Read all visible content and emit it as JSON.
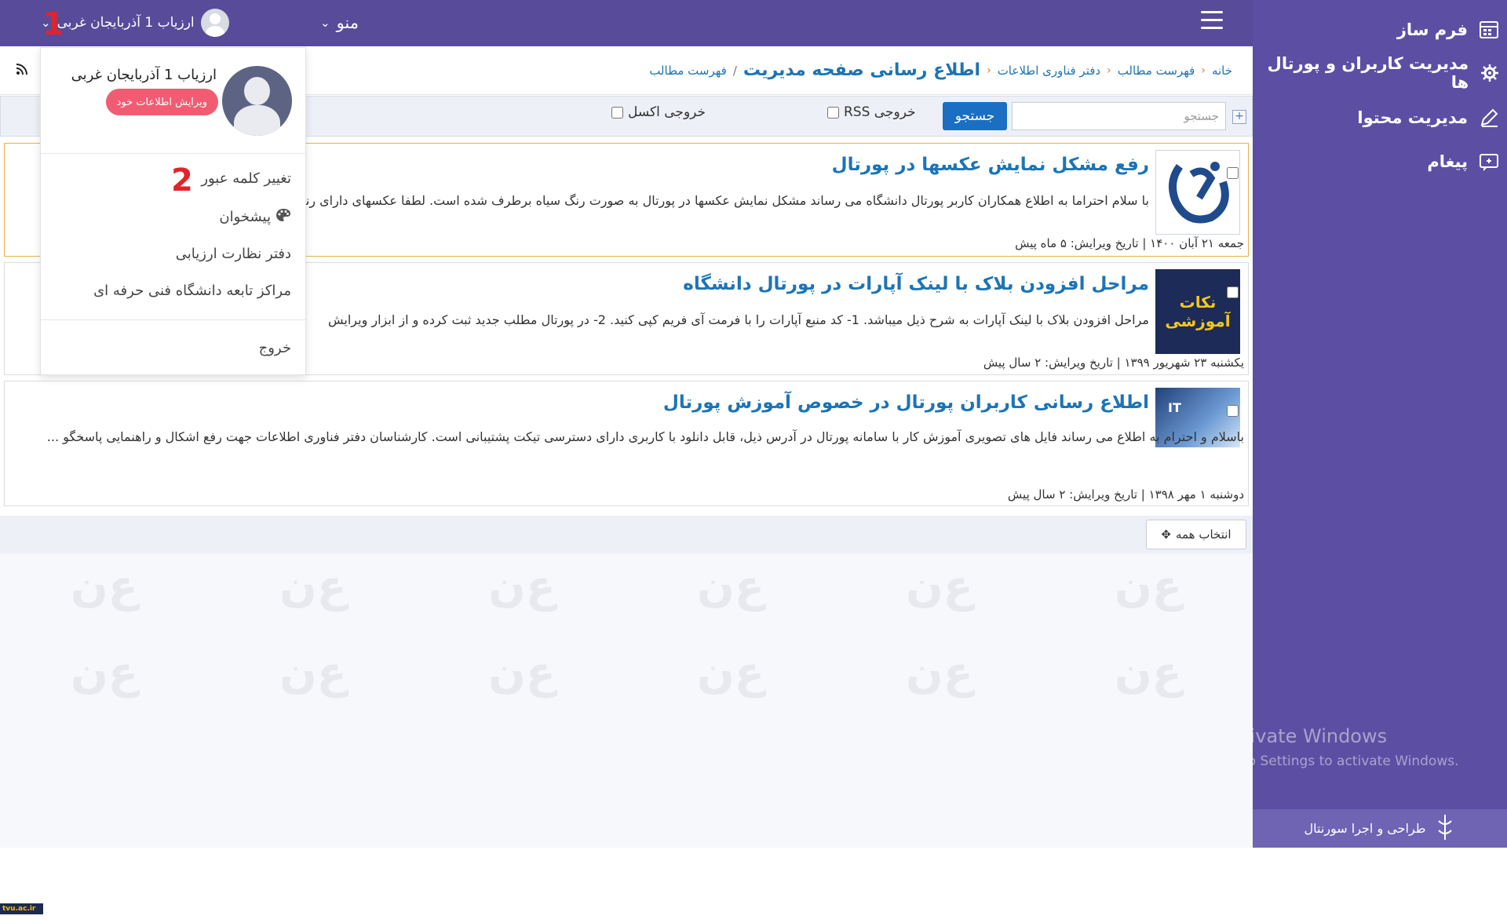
{
  "topbar": {
    "menu_label": "منو",
    "user_label": "ارزیاب 1 آذربایجان غربی",
    "annotation_1": "1",
    "annotation_2": "2"
  },
  "sidebar": {
    "items": [
      {
        "label": "فرم ساز",
        "icon": "calendar-icon"
      },
      {
        "label": "مدیریت کاربران و پورتال ها",
        "icon": "users-gear-icon"
      },
      {
        "label": "مدیریت محتوا",
        "icon": "edit-icon"
      },
      {
        "label": "پیغام",
        "icon": "message-icon"
      }
    ],
    "footer": "طراحی و اجرا سورنتال"
  },
  "watermark": {
    "line1": "Activate Windows",
    "line2": "Go to Settings to activate Windows."
  },
  "breadcrumb": {
    "home": "خانه",
    "list": "فهرست مطالب",
    "office": "دفتر فناوری اطلاعات",
    "title": "اطلاع رسانی صفحه مدیریت",
    "slash": "/",
    "list_link": "فهرست مطالب"
  },
  "toolbar": {
    "search_placeholder": "جستجو",
    "search_button": "جستجو",
    "rss_label": "خروجی RSS",
    "excel_label": "خروجی اکسل"
  },
  "items": [
    {
      "title": "رفع مشکل نمایش عکسها در پورتال",
      "text": "با سلام احتراما به اطلاع همکاران کاربر پورتال دانشگاه می رساند مشکل نمایش عکسها در پورتال به صورت رنگ سیاه برطرف شده است. لطفا عکسهای دارای رنگ سیاه را مجددا بارگذاری نمایید",
      "meta": "جمعه ۲۱ آبان ۱۴۰۰ | تاریخ ویرایش: ۵ ماه پیش"
    },
    {
      "title": "مراحل افزودن بلاک با لینک آپارات در پورتال دانشگاه",
      "text": "مراحل افزودن بلاک با لینک آپارات به شرح ذیل میباشد. 1- کد منبع آپارات را با فرمت آی فریم کپی کنید. 2- در پورتال مطلب جدید ثبت کرده و از ابزار ویرایش",
      "meta": "یکشنبه ۲۳ شهریور ۱۳۹۹ | تاریخ ویرایش: ۲ سال پیش",
      "thumb_text": "نکات آموزشی"
    },
    {
      "title": "اطلاع رسانی کاربران پورتال در خصوص آموزش پورتال",
      "text": "باسلام و احترام به اطلاع می رساند فایل های تصویری آموزش کار با سامانه پورتال در آدرس ذیل، قابل دانلود با کاربری دارای دسترسی تیکت پشتیبانی است. کارشناسان دفتر فناوری اطلاعات جهت رفع اشکال و راهنمایی پاسخگو ...",
      "meta": "دوشنبه ۱ مهر ۱۳۹۸ | تاریخ ویرایش: ۲ سال پیش",
      "thumb_text": "IT"
    }
  ],
  "select_all": "انتخاب همه",
  "dropdown": {
    "name": "ارزیاب 1 آذربایجان غربی",
    "edit_button": "ویرایش اطلاعات خود",
    "items": [
      "تغییر کلمه عبور",
      "پیشخوان",
      "دفتر نظارت ارزیابی",
      "مراکز تابعه دانشگاه فنی حرفه ای",
      "خروج"
    ]
  },
  "bottom_logo": "tvu.ac.ir"
}
